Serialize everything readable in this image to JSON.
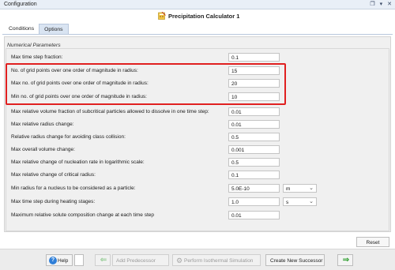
{
  "window": {
    "title": "Configuration",
    "icons": [
      "restore-icon",
      "minimize-icon",
      "close-icon"
    ]
  },
  "header": {
    "title": "Precipitation Calculator 1",
    "icon": "calculator-icon"
  },
  "tabs": [
    {
      "label": "Conditions",
      "active": false
    },
    {
      "label": "Options",
      "active": true
    }
  ],
  "group": {
    "label": "Numerical Parameters"
  },
  "params": [
    {
      "label": "Max time step fraction:",
      "value": "0.1"
    },
    {
      "label": "No. of grid points over one order of magnitude in radius:",
      "value": "15"
    },
    {
      "label": "Max no. of grid points over one order of magnitude in radius:",
      "value": "20"
    },
    {
      "label": "Min no. of grid points over one order of magnitude in radius:",
      "value": "10"
    },
    {
      "label": "Max relative volume fraction of subcritical particles allowed to dissolve in one time step:",
      "value": "0.01"
    },
    {
      "label": "Max relative radius change:",
      "value": "0.01"
    },
    {
      "label": "Relative radius change for avoiding class collision:",
      "value": "0.5"
    },
    {
      "label": "Max overall volume change:",
      "value": "0.001"
    },
    {
      "label": "Max relative change of nucleation rate in logarithmic scale:",
      "value": "0.5"
    },
    {
      "label": "Max relative change of critical radius:",
      "value": "0.1"
    },
    {
      "label": "Min radius for a nucleus to be considered as a particle:",
      "value": "5.0E-10",
      "unit": "m"
    },
    {
      "label": "Max time step during heating stages:",
      "value": "1.0",
      "unit": "s"
    },
    {
      "label": "Maximum relative solute composition change at each time step",
      "value": "0.01"
    }
  ],
  "buttons": {
    "reset": "Reset",
    "help": "Help",
    "add_predecessor": "Add Predecessor",
    "perform_isothermal": "Perform Isothermal Simulation",
    "create_successor": "Create New Successor"
  },
  "colors": {
    "highlight": "#e02020",
    "tab_active": "#d9e4f2",
    "accent_green": "#3aa33a",
    "help_blue": "#2f7fd8"
  }
}
